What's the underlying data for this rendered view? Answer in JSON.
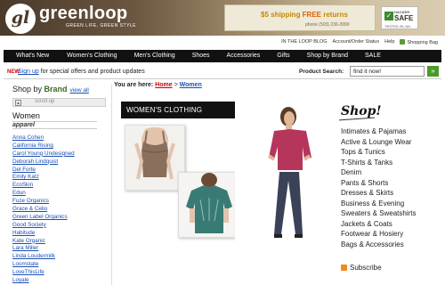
{
  "header": {
    "logo_mark": "gl",
    "logo_text": "greenloop",
    "tagline": "GREEN LIFE, GREEN STYLE",
    "promo_text_pre": "$5 shipping ",
    "promo_text_free": "FREE",
    "promo_text_post": " returns",
    "promo_phone": "phone (503) 236-3999",
    "hacker_safe_top": "HACKER",
    "hacker_safe_main": "SAFE",
    "hacker_safe_date": "TESTED 25-JUL"
  },
  "utility": {
    "items": [
      "IN THE LOOP BLOG",
      "Account/Order Status",
      "Help",
      "Shopping Bag"
    ]
  },
  "nav": {
    "items": [
      "What's New",
      "Women's Clothing",
      "Men's Clothing",
      "Shoes",
      "Accessories",
      "Gifts",
      "Shop by Brand",
      "SALE"
    ]
  },
  "signup": {
    "new_badge": "NEW",
    "link_text": "Sign up",
    "rest_text": " for special offers and product updates"
  },
  "search": {
    "label": "Product Search:",
    "value": "find it now!",
    "go_glyph": "»"
  },
  "sidebar": {
    "shop_by": "Shop by ",
    "brand": "Brand",
    "view_all": "view all",
    "scroll_text": "scroll up",
    "category": "Women",
    "subcategory": "apparel",
    "brands": [
      "Anna Cohen",
      "California Rising",
      "Carol Young Undesigned",
      "Deborah Lindquist",
      "Del Forte",
      "Emily Katz",
      "EcoSkin",
      "Edun",
      "Fuze Organics",
      "Grace & Celio",
      "Green Label Organics",
      "Good Society",
      "Habitude",
      "Kate Organic",
      "Lara Miller",
      "Linda Loudermilk",
      "Loomstate",
      "LoveThisLife",
      "Loyale"
    ]
  },
  "breadcrumb": {
    "prefix": "You are here:",
    "home": "Home",
    "sep": ">",
    "current": "Women"
  },
  "main": {
    "banner": "WOMEN'S CLOTHING",
    "shop_title": "Shop!",
    "categories": [
      "Intimates & Pajamas",
      "Active & Lounge Wear",
      "Tops & Tunics",
      "T-Shirts & Tanks",
      "Denim",
      "Pants & Shorts",
      "Dresses & Skirts",
      "Business & Evening",
      "Sweaters & Sweatshirts",
      "Jackets & Coats",
      "Footwear & Hosiery",
      "Bags & Accessories"
    ],
    "subscribe": "Subscribe"
  }
}
